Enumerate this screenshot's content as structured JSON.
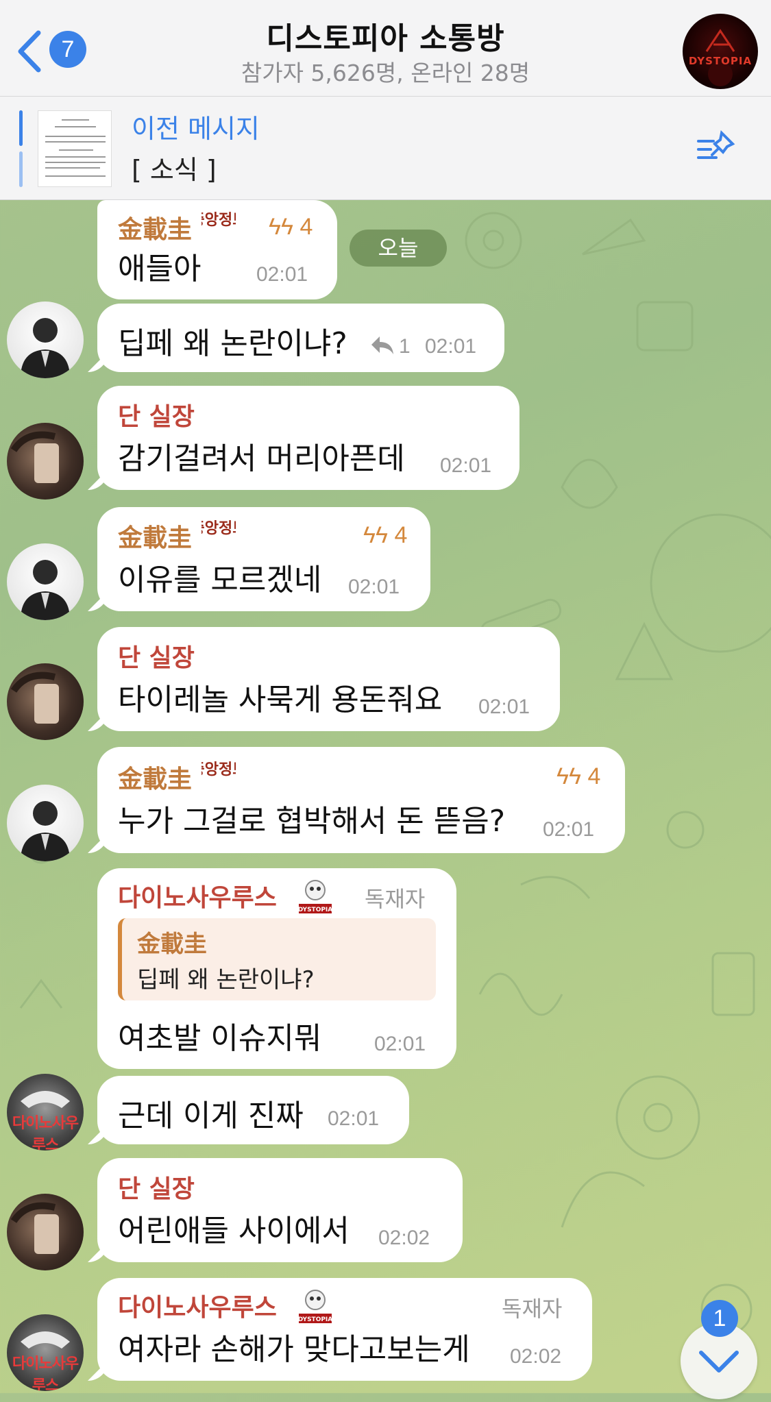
{
  "header": {
    "back_count": "7",
    "title": "디스토피아 소통방",
    "subtitle": "참가자 5,626명, 온라인 28명",
    "group_avatar_text": "DYSTOPIA"
  },
  "pinned": {
    "title": "이전 메시지",
    "text": "[ 소식 ]"
  },
  "date_label": "오늘",
  "badges": {
    "kim_badge_text": "중앙정보",
    "dino_badge_text": "DYSTOPIA"
  },
  "messages": [
    {
      "sender": "金載圭",
      "boost": "4",
      "text": "애들아",
      "time": "02:01"
    },
    {
      "text": "딥페 왜 논란이냐?",
      "reply_count": "1",
      "time": "02:01"
    },
    {
      "sender": "단 실장",
      "text": "감기걸려서 머리아픈데",
      "time": "02:01"
    },
    {
      "sender": "金載圭",
      "boost": "4",
      "text": "이유를 모르겠네",
      "time": "02:01"
    },
    {
      "sender": "단 실장",
      "text": "타이레놀 사묵게 용돈줘요",
      "time": "02:01"
    },
    {
      "sender": "金載圭",
      "boost": "4",
      "text": "누가 그걸로 협박해서 돈 뜯음?",
      "time": "02:01"
    },
    {
      "sender": "다이노사우루스",
      "role": "독재자",
      "quote_name": "金載圭",
      "quote_text": "딥페 왜 논란이냐?",
      "text": "여초발 이슈지뭐",
      "time": "02:01"
    },
    {
      "text": "근데 이게 진짜",
      "time": "02:01"
    },
    {
      "sender": "단 실장",
      "text": "어린애들 사이에서",
      "time": "02:02"
    },
    {
      "sender": "다이노사우루스",
      "role": "독재자",
      "text": "여자라 손해가 맞다고보는게",
      "time": "02:02"
    }
  ],
  "avatars": {
    "dino_text": "다이노사우루스"
  },
  "scroll": {
    "unread": "1"
  },
  "colors": {
    "accent": "#3b82e8",
    "kim_name": "#c07a3c",
    "dan_name": "#c0463a"
  }
}
